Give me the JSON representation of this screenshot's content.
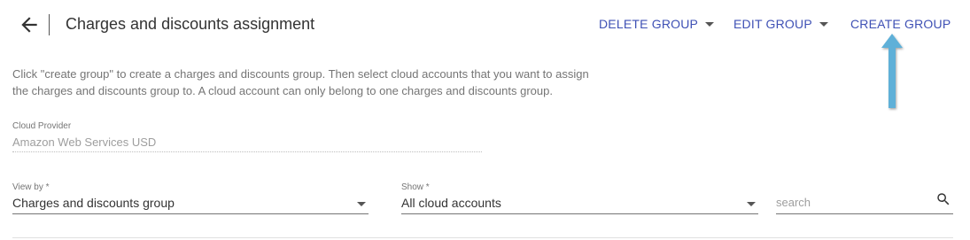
{
  "header": {
    "title": "Charges and discounts assignment",
    "actions": {
      "delete_group": "DELETE GROUP",
      "edit_group": "EDIT GROUP",
      "create_group": "CREATE GROUP"
    },
    "accent_color": "#3f51b5"
  },
  "annotation": {
    "arrow_color": "#5fb0d8",
    "points_to": "create_group"
  },
  "intro": {
    "line1": "Click \"create group\" to create a charges and discounts group. Then select cloud accounts that you want to assign",
    "line2": "the charges and discounts group to. A cloud account can only belong to one charges and discounts group."
  },
  "cloud_provider": {
    "label": "Cloud Provider",
    "value": "Amazon Web Services USD"
  },
  "filters": {
    "view_by": {
      "label": "View by *",
      "value": "Charges and discounts group"
    },
    "show": {
      "label": "Show *",
      "value": "All cloud accounts"
    },
    "search": {
      "placeholder": "search"
    }
  }
}
